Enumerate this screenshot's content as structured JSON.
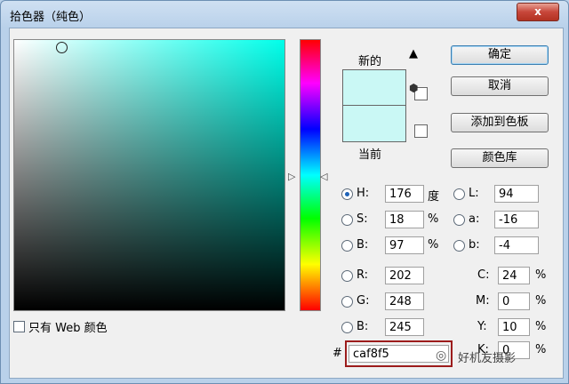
{
  "window": {
    "title": "拾色器（纯色）",
    "close": "x"
  },
  "swatches": {
    "new_label": "新的",
    "current_label": "当前",
    "color": "#caf8f5"
  },
  "buttons": {
    "ok": "确定",
    "cancel": "取消",
    "add_swatch": "添加到色板",
    "libraries": "颜色库"
  },
  "hsb": {
    "h": {
      "label": "H:",
      "value": "176",
      "unit": "度",
      "selected": true
    },
    "s": {
      "label": "S:",
      "value": "18",
      "unit": "%"
    },
    "b": {
      "label": "B:",
      "value": "97",
      "unit": "%"
    }
  },
  "lab": {
    "l": {
      "label": "L:",
      "value": "94"
    },
    "a": {
      "label": "a:",
      "value": "-16"
    },
    "b": {
      "label": "b:",
      "value": "-4"
    }
  },
  "rgb": {
    "r": {
      "label": "R:",
      "value": "202"
    },
    "g": {
      "label": "G:",
      "value": "248"
    },
    "b": {
      "label": "B:",
      "value": "245"
    }
  },
  "cmyk": {
    "c": {
      "label": "C:",
      "value": "24",
      "unit": "%"
    },
    "m": {
      "label": "M:",
      "value": "0",
      "unit": "%"
    },
    "y": {
      "label": "Y:",
      "value": "10",
      "unit": "%"
    },
    "k": {
      "label": "K:",
      "value": "0",
      "unit": "%"
    }
  },
  "hex": {
    "prefix": "#",
    "value": "caf8f5"
  },
  "web_only": {
    "label": "只有 Web 颜色"
  },
  "watermark": "好机友摄影"
}
